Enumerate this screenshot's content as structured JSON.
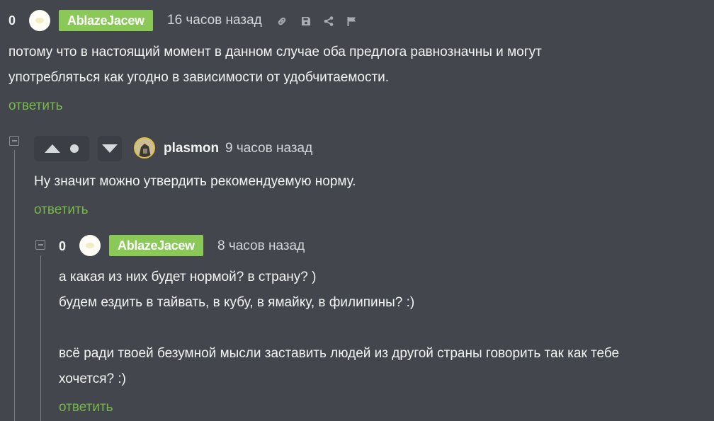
{
  "comment1": {
    "score": "0",
    "author": "AblazeJacew",
    "time": "16 часов назад",
    "icons": [
      "link-icon",
      "save-icon",
      "share-icon",
      "flag-icon"
    ],
    "text_line1": "потому что в настоящий момент в данном случае оба предлога равнозначны и могут",
    "text_line2": "употребляться как угодно в зависимости от удобчитаемости.",
    "reply_label": "ответить"
  },
  "comment2": {
    "author": "plasmon",
    "time": "9 часов назад",
    "text": "Ну значит можно утвердить рекомендуемую норму.",
    "reply_label": "ответить",
    "upvote_icon": "triangle-up-icon",
    "downvote_icon": "triangle-down-icon"
  },
  "comment3": {
    "score": "0",
    "author": "AblazeJacew",
    "time": "8 часов назад",
    "line1": "а какая из них будет нормой? в страну? )",
    "line2": "будем ездить в тайвать, в кубу, в ямайку, в филипины? :)",
    "line3": "всё ради твоей безумной мысли заставить людей из другой страны говорить так как тебе",
    "line4": "хочется? :)",
    "reply_label": "ответить"
  }
}
